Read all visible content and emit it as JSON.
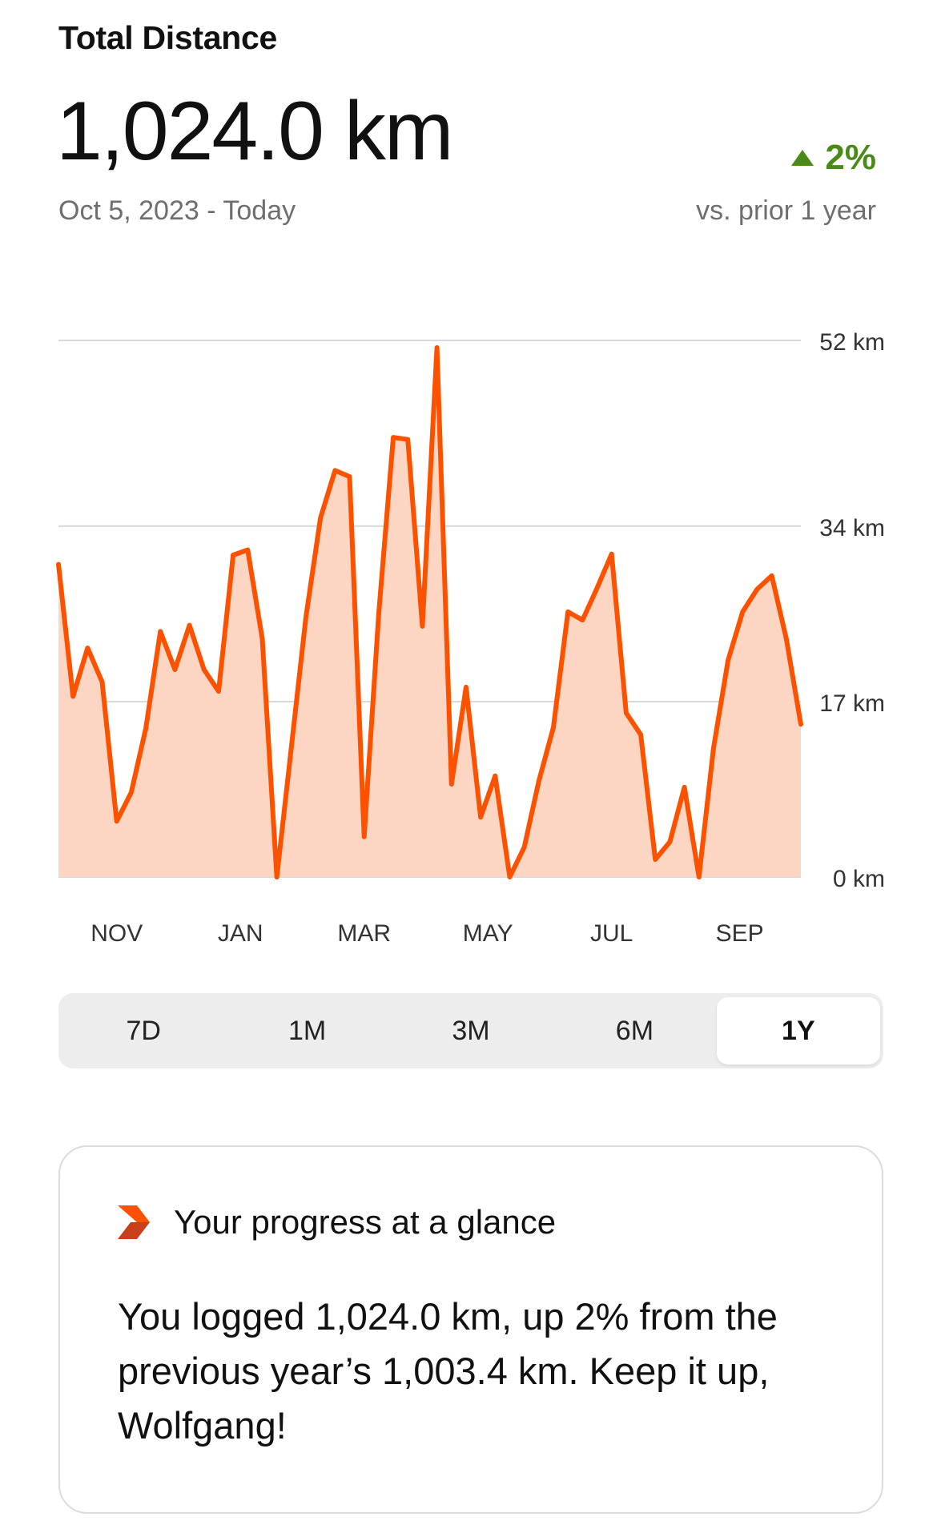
{
  "header": {
    "title": "Total Distance",
    "value": "1,024.0 km",
    "date_range": "Oct 5, 2023 - Today",
    "change_percent": "2%",
    "change_direction": "up",
    "compare_label": "vs. prior 1 year"
  },
  "colors": {
    "accent": "#fc5200",
    "fill": "#fdd5c3",
    "positive": "#4a8a16",
    "grid": "#d9d9d9"
  },
  "chart_data": {
    "type": "area",
    "y_ticks": [
      "52 km",
      "34 km",
      "17 km",
      "0 km"
    ],
    "y_tick_values": [
      52,
      34,
      17,
      0
    ],
    "ylim": [
      0,
      52
    ],
    "x_labels": [
      "NOV",
      "JAN",
      "MAR",
      "MAY",
      "JUL",
      "SEP"
    ],
    "x_label_weeks": [
      4,
      12.5,
      21,
      29.5,
      38,
      46.8
    ],
    "grid": true,
    "series": [
      {
        "values": [
          30.3,
          17.5,
          22.2,
          18.9,
          5.4,
          8.2,
          14.4,
          23.8,
          20.1,
          24.4,
          20.1,
          18.0,
          31.2,
          31.7,
          23.1,
          0.0,
          12.6,
          25.2,
          34.8,
          39.4,
          38.8,
          3.9,
          25.5,
          42.6,
          42.4,
          24.3,
          51.3,
          9.0,
          18.4,
          5.8,
          9.8,
          0.0,
          2.9,
          9.3,
          14.5,
          25.7,
          24.9,
          28.0,
          31.3,
          15.9,
          13.8,
          1.7,
          3.4,
          8.7,
          0.0,
          12.5,
          21.0,
          25.7,
          27.9,
          29.2,
          23.1,
          14.8
        ]
      }
    ]
  },
  "range_selector": {
    "options": [
      "7D",
      "1M",
      "3M",
      "6M",
      "1Y"
    ],
    "selected": "1Y"
  },
  "progress_card": {
    "icon": "strava-chevron-icon",
    "heading": "Your progress at a glance",
    "body": "You logged 1,024.0 km, up 2% from the previous year’s 1,003.4 km. Keep it up, Wolfgang!"
  }
}
